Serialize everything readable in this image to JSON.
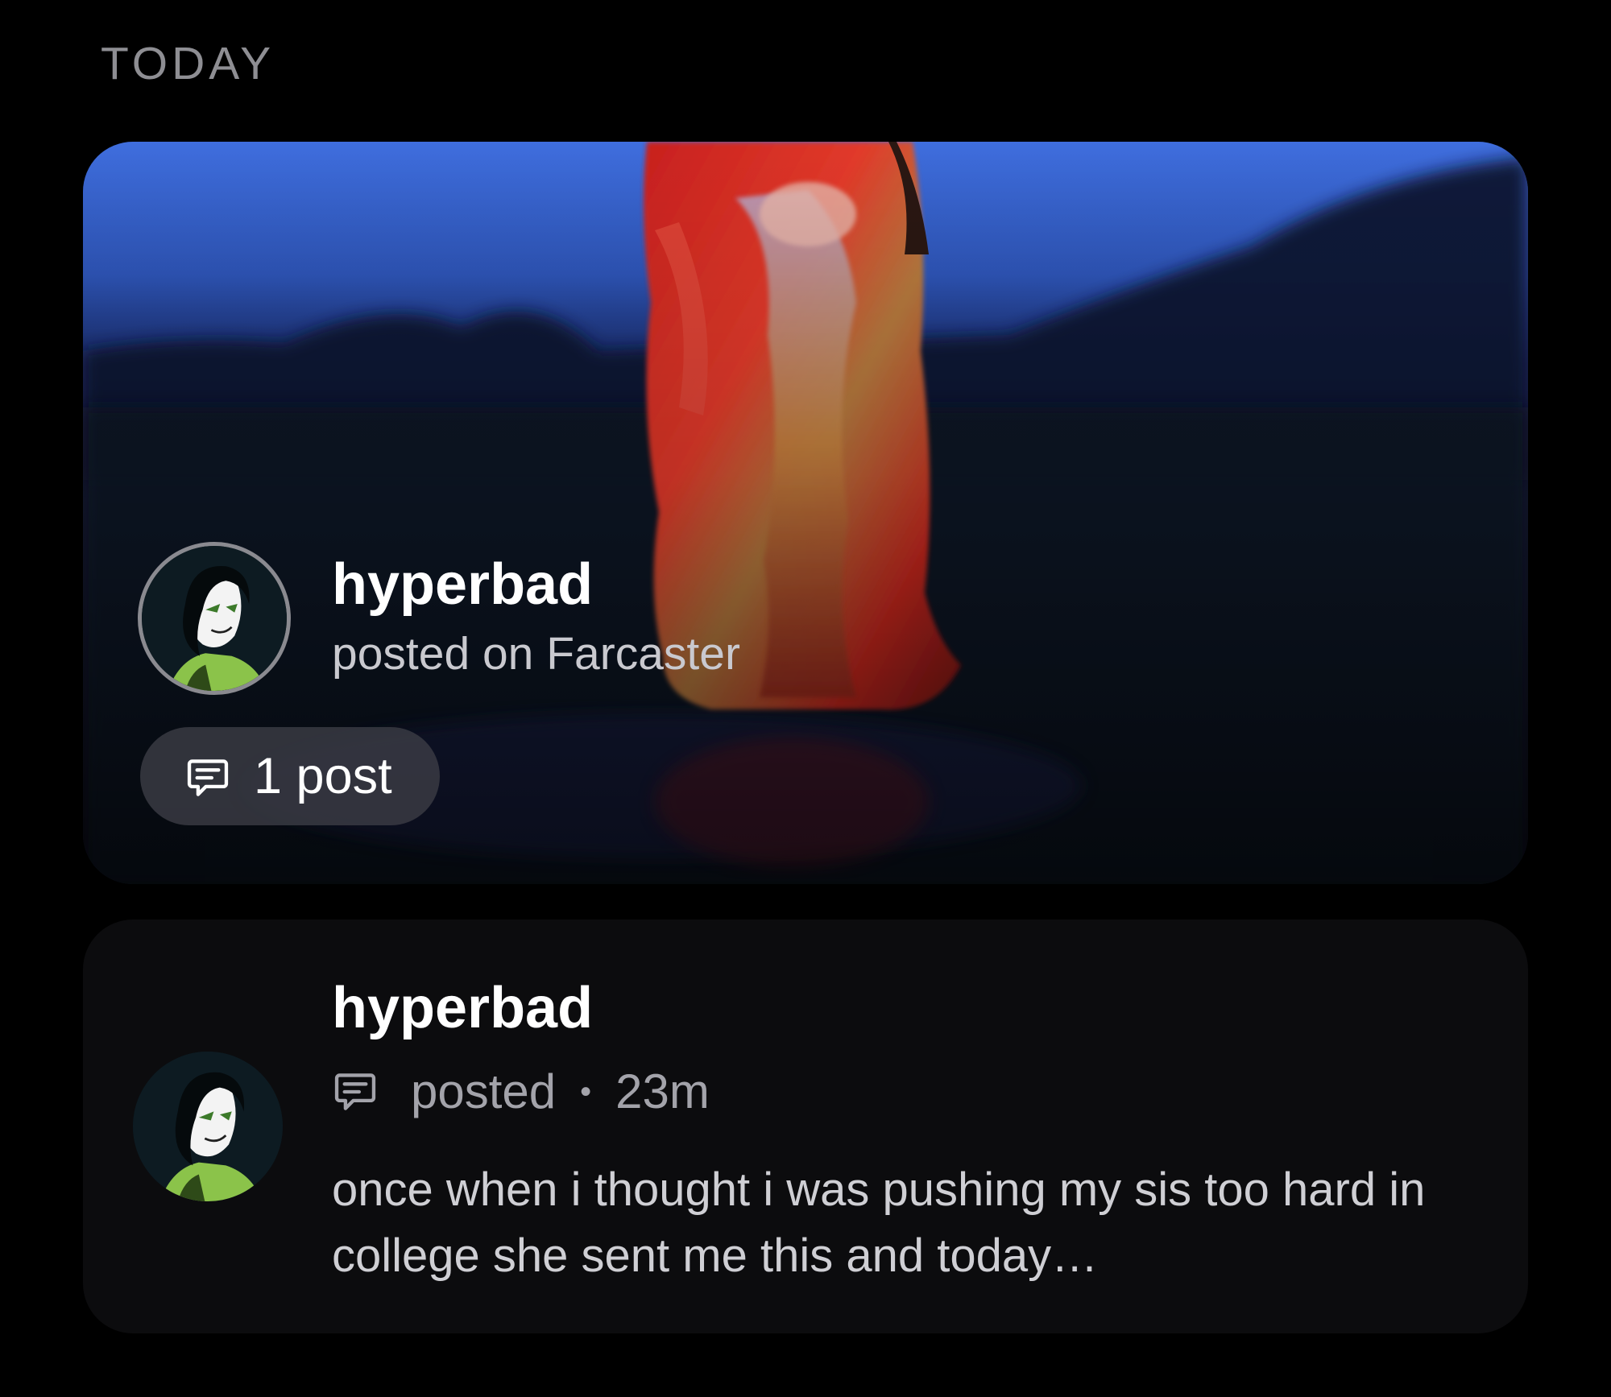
{
  "section": {
    "label": "TODAY"
  },
  "hero": {
    "author": "hyperbad",
    "subtitle": "posted on Farcaster",
    "chip_label": "1 post",
    "chip_icon": "chat-bubble-icon"
  },
  "post": {
    "author": "hyperbad",
    "action": "posted",
    "separator": "•",
    "time": "23m",
    "body": "once when i thought i was pushing my sis too hard in college she sent me this and today…",
    "icon": "chat-bubble-icon"
  },
  "colors": {
    "background": "#000000",
    "card": "#0c0c0e",
    "secondary_text": "#a3a3aa",
    "chip": "#3a3c44"
  }
}
